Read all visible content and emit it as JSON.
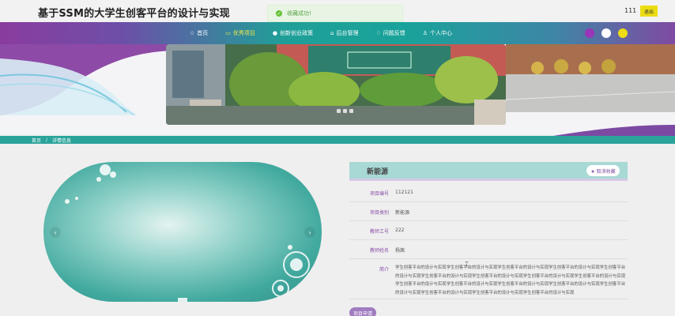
{
  "header": {
    "site_title": "基于SSM的大学生创客平台的设计与实现",
    "toast": "收藏成功!",
    "user_number": "111",
    "logout_label": "退出"
  },
  "nav": {
    "items": [
      {
        "label": "首页",
        "icon": "star-icon"
      },
      {
        "label": "优秀项目",
        "icon": "folder-icon"
      },
      {
        "label": "创新创业政策",
        "icon": "info-circle-icon"
      },
      {
        "label": "后台管理",
        "icon": "admin-icon"
      },
      {
        "label": "问题反馈",
        "icon": "feedback-icon"
      },
      {
        "label": "个人中心",
        "icon": "user-icon"
      }
    ],
    "active_index": 1,
    "theme_colors": [
      "#9a34b8",
      "#ffffff",
      "#ecdc12"
    ]
  },
  "breadcrumb": {
    "home": "首页",
    "separator": "/",
    "current": "详情信息"
  },
  "detail": {
    "title": "新能源",
    "favorite_label": "★ 取消收藏",
    "fields": [
      {
        "label": "项目编号",
        "value": "112121"
      },
      {
        "label": "项目类别",
        "value": "新能源"
      },
      {
        "label": "教师工号",
        "value": "222"
      },
      {
        "label": "教师姓名",
        "value": "杨茜"
      }
    ],
    "intro_label": "简介",
    "intro_text": "学生创客平台的设计与实现学生创客平台的设计与实现学生创客平台的设计与实现学生创客平台的设计与实现学生创客平台的设计与实现学生创客平台的设计与实现学生创客平台的设计与实现学生创客平台的设计与实现学生创客平台的设计与实现学生创客平台的设计与实现学生创客平台的设计与实现学生创客平台的设计与实现学生创客平台的设计与实现学生创客平台的设计与实现学生创客平台的设计与实现学生创客平台的设计与实现学生创客平台的设计与实现",
    "apply_label": "项目申请"
  },
  "colors": {
    "accent_teal": "#2aa39a",
    "accent_purple": "#8a4fa8",
    "logout_yellow": "#ecdc12"
  }
}
